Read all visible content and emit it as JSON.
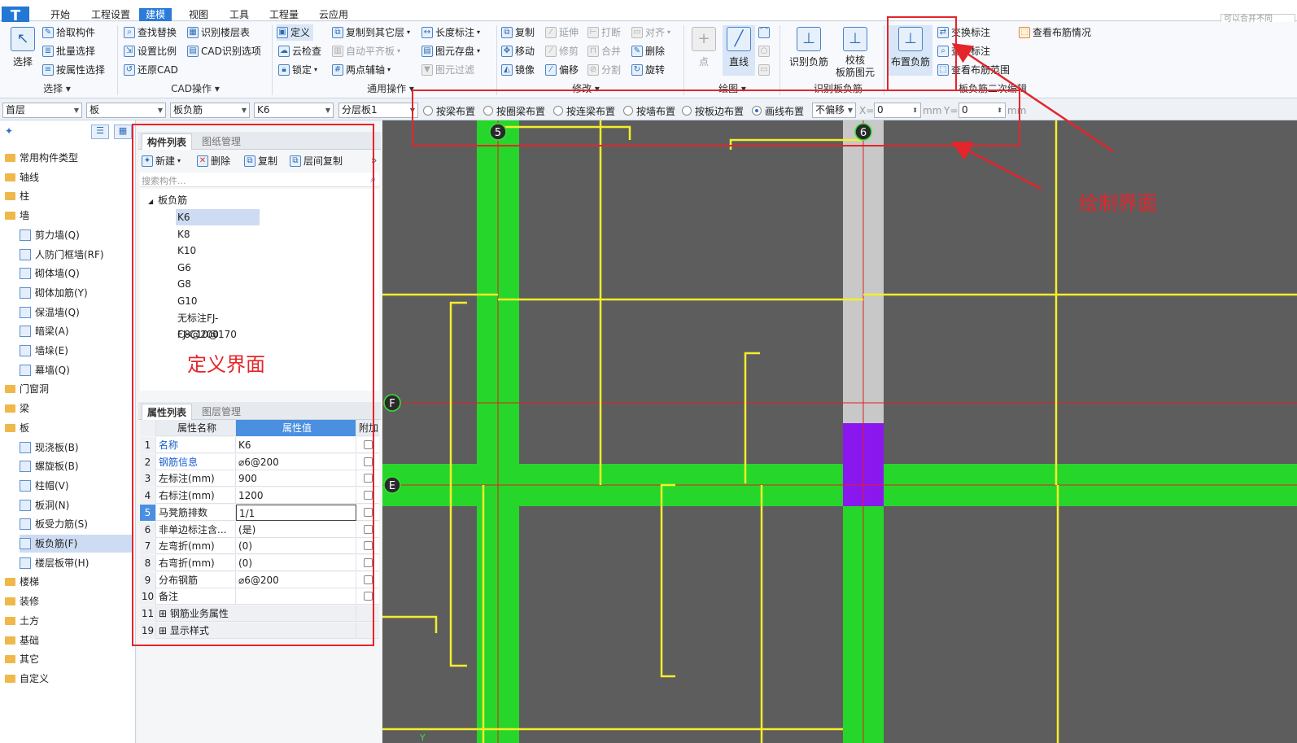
{
  "menubar": {
    "tabs": [
      "开始",
      "工程设置",
      "建模",
      "视图",
      "工具",
      "工程量",
      "云应用"
    ],
    "active_tab": "建模",
    "search_hint": "可以合并不同"
  },
  "ribbon": {
    "select": {
      "big": "选择",
      "items": [
        "拾取构件",
        "批量选择",
        "按属性选择"
      ],
      "group": "选择"
    },
    "cad": {
      "items": [
        "查找替换",
        "设置比例",
        "还原CAD",
        "识别楼层表",
        "CAD识别选项"
      ],
      "group": "CAD操作"
    },
    "common": {
      "items": [
        "定义",
        "云检查",
        "锁定",
        "复制到其它层",
        "自动平齐板",
        "两点辅轴",
        "长度标注",
        "图元存盘",
        "图元过滤"
      ],
      "group": "通用操作"
    },
    "modify": {
      "items": [
        "复制",
        "移动",
        "镜像",
        "延伸",
        "修剪",
        "偏移",
        "打断",
        "合并",
        "分割",
        "对齐",
        "删除",
        "旋转"
      ],
      "group": "修改"
    },
    "draw": {
      "point": "点",
      "line": "直线",
      "group": "绘图"
    },
    "recog": {
      "recognize": "识别负筋",
      "check": "校核",
      "check2": "板筋图元",
      "group": "识别板负筋"
    },
    "secondary": {
      "place": "布置负筋",
      "swap": "交换标注",
      "view_label": "查改标注",
      "view_range": "查看布筋范围",
      "view_status": "查看布筋情况",
      "group": "板负筋二次编辑"
    }
  },
  "toolbar2": {
    "floor": "首层",
    "category": "板",
    "type": "板负筋",
    "name": "K6",
    "layer": "分层板1",
    "radios": [
      "按梁布置",
      "按圈梁布置",
      "按连梁布置",
      "按墙布置",
      "按板边布置",
      "画线布置"
    ],
    "radio_selected": "画线布置",
    "offset": "不偏移",
    "x_label": "X=",
    "x_value": "0",
    "y_label": "Y=",
    "y_value": "0",
    "unit": "mm"
  },
  "nav": {
    "items": [
      {
        "label": "常用构件类型",
        "folder": true
      },
      {
        "label": "轴线",
        "folder": true
      },
      {
        "label": "柱",
        "folder": true
      },
      {
        "label": "墙",
        "folder": true
      },
      {
        "label": "剪力墙(Q)",
        "folder": false
      },
      {
        "label": "人防门框墙(RF)",
        "folder": false
      },
      {
        "label": "砌体墙(Q)",
        "folder": false
      },
      {
        "label": "砌体加筋(Y)",
        "folder": false
      },
      {
        "label": "保温墙(Q)",
        "folder": false
      },
      {
        "label": "暗梁(A)",
        "folder": false
      },
      {
        "label": "墙垛(E)",
        "folder": false
      },
      {
        "label": "幕墙(Q)",
        "folder": false
      },
      {
        "label": "门窗洞",
        "folder": true
      },
      {
        "label": "梁",
        "folder": true
      },
      {
        "label": "板",
        "folder": true
      },
      {
        "label": "现浇板(B)",
        "folder": false
      },
      {
        "label": "螺旋板(B)",
        "folder": false
      },
      {
        "label": "柱帽(V)",
        "folder": false
      },
      {
        "label": "板洞(N)",
        "folder": false
      },
      {
        "label": "板受力筋(S)",
        "folder": false
      },
      {
        "label": "板负筋(F)",
        "folder": false,
        "selected": true
      },
      {
        "label": "楼层板带(H)",
        "folder": false
      },
      {
        "label": "楼梯",
        "folder": true
      },
      {
        "label": "装修",
        "folder": true
      },
      {
        "label": "土方",
        "folder": true
      },
      {
        "label": "基础",
        "folder": true
      },
      {
        "label": "其它",
        "folder": true
      },
      {
        "label": "自定义",
        "folder": true
      }
    ]
  },
  "components": {
    "tabs": [
      "构件列表",
      "图纸管理"
    ],
    "new": "新建",
    "delete": "删除",
    "copy": "复制",
    "layer_copy": "层间复制",
    "search_placeholder": "搜索构件...",
    "root": "板负筋",
    "items": [
      "K6",
      "K8",
      "K10",
      "G6",
      "G8",
      "G10",
      "无标注FJ-C8@200",
      "FJ-C10@170"
    ],
    "selected": "K6"
  },
  "properties": {
    "tabs": [
      "属性列表",
      "图层管理"
    ],
    "headers": [
      "属性名称",
      "属性值",
      "附加"
    ],
    "rows": [
      {
        "num": "1",
        "name": "名称",
        "value": "K6",
        "blue": true
      },
      {
        "num": "2",
        "name": "钢筋信息",
        "value": "⌀6@200",
        "blue": true
      },
      {
        "num": "3",
        "name": "左标注(mm)",
        "value": "900"
      },
      {
        "num": "4",
        "name": "右标注(mm)",
        "value": "1200"
      },
      {
        "num": "5",
        "name": "马凳筋排数",
        "value": "1/1",
        "active": true
      },
      {
        "num": "6",
        "name": "非单边标注含...",
        "value": "(是)"
      },
      {
        "num": "7",
        "name": "左弯折(mm)",
        "value": "(0)"
      },
      {
        "num": "8",
        "name": "右弯折(mm)",
        "value": "(0)"
      },
      {
        "num": "9",
        "name": "分布钢筋",
        "value": "⌀6@200"
      },
      {
        "num": "10",
        "name": "备注",
        "value": ""
      },
      {
        "num": "11",
        "name": "钢筋业务属性",
        "value": "",
        "group": true
      },
      {
        "num": "19",
        "name": "显示样式",
        "value": "",
        "group": true
      }
    ]
  },
  "canvas": {
    "axes": {
      "col5": "5",
      "col6": "6",
      "rowF": "F",
      "rowE": "E"
    }
  },
  "annotations": {
    "define": "定义界面",
    "draw": "绘制界面"
  }
}
